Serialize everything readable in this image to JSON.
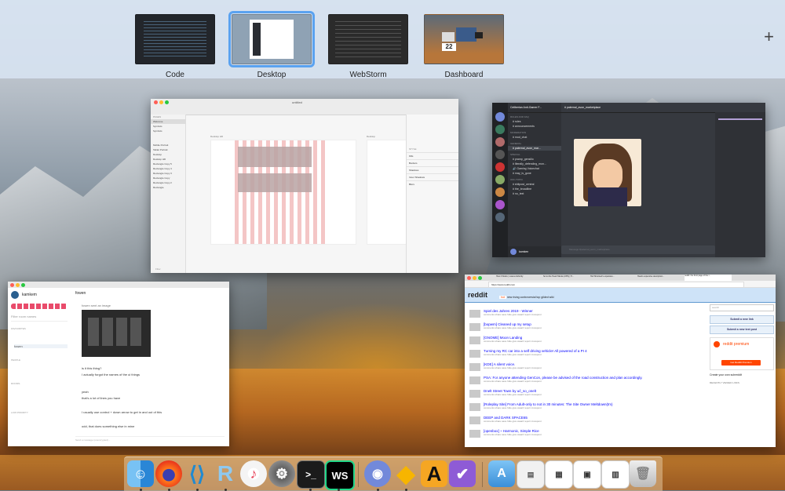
{
  "spaces": [
    {
      "label": "Code"
    },
    {
      "label": "Desktop",
      "selected": true
    },
    {
      "label": "WebStorm"
    },
    {
      "label": "Dashboard"
    }
  ],
  "add_space_icon": "plus-icon",
  "dashboard_clock": "22",
  "sketch": {
    "title": "untitled",
    "pages_header": "PAGES",
    "pages": [
      "Welcome",
      "Symbols",
      "Symbols"
    ],
    "layers": [
      "Mobile Portrait",
      "Tablet Portrait",
      "Desktop",
      "Desktop HD",
      "Rectangle Copy 5",
      "Rectangle Copy 4",
      "Rectangle Copy 3",
      "Rectangle Copy",
      "Rectangle Copy 2",
      "Rectangle"
    ],
    "artboard_label": "Desktop HD",
    "artboard2_label": "Desktop",
    "inspector": [
      "STYLE",
      "Fills",
      "Borders",
      "Shadows",
      "Inner Shadows",
      "Blurs"
    ],
    "filter_placeholder": "Filter"
  },
  "discord": {
    "server": "Celiberian Anti-Gamer F...",
    "channel": "paternal_avon_marketplace",
    "channels": [
      "rules",
      "announcements",
      "mod_chat",
      "paternal_avon_mar...",
      "pramp_gensilio",
      "literally_defending_mon...",
      "Gaming Voicechat",
      "may_is_gone",
      "shitpost_central",
      "the_broadline",
      "no_text"
    ],
    "categories": [
      "RULES AND FAQ",
      "MODERATION",
      "GENERAL",
      "SPECIAL",
      "OFF-TOPIC"
    ],
    "user": "kamken",
    "message_placeholder": "Message #paternal_avon_marketplace"
  },
  "chat": {
    "user": "kamkem",
    "filter_placeholder": "Filter room names",
    "sections": [
      "FAVOURITES",
      "PEOPLE",
      "ROOMS",
      "LOW PRIORITY"
    ],
    "rooms": [
      "fowen"
    ],
    "messages": [
      "fowen sent an image",
      "is it this thing?",
      "I actually forgot the names of the ui things",
      "yeah",
      "that's a lot of lines you have",
      "I usually use control + down arrow to get in and out of this",
      "odd, that does something else in mine"
    ],
    "composer_placeholder": "Send a message (unencrypted)..."
  },
  "browser": {
    "url": "https://www.reddit.com",
    "tabs": [
      "How it Works | Lowes Authority",
      "So let the Heart  Tabula (UPS) | Ti...",
      "Hell Shorsted's expansive...",
      "Hearts expensive description...",
      "reddit: the front page of the i..."
    ],
    "site": "reddit",
    "sort_tabs": [
      "hot",
      "new",
      "rising",
      "controversial",
      "top",
      "gilded",
      "wiki"
    ],
    "posts": [
      {
        "rank": "1",
        "score": "•",
        "title": "Spiel des Jahres 2019 - Winner"
      },
      {
        "rank": "2",
        "score": "•",
        "title": "[bopwm] Cleaned up my setup"
      },
      {
        "rank": "3",
        "score": "•",
        "title": "[GNOME] Moon Landing"
      },
      {
        "rank": "4",
        "score": "•",
        "title": "Turning my RC car into a self driving vehicle! All powered of a PI 4"
      },
      {
        "rank": "5",
        "score": "•",
        "title": "[KDE] A silent voice."
      },
      {
        "rank": "6",
        "score": "•",
        "title": "PSA: For anyone attending GenCon, please be advised of the road construction and plan accordingly."
      },
      {
        "rank": "7",
        "score": "•",
        "title": "Dnelt Street Town by u/i_so_onelt"
      },
      {
        "rank": "8",
        "score": "•",
        "title": "[Roleplay Site] From Adult-only to not in 30 minutes: The Site Owner Meltdown(tm)"
      },
      {
        "rank": "9",
        "score": "•",
        "title": "DEEP and DARK SPACE65"
      },
      {
        "rank": "10",
        "score": "•",
        "title": "[openbox] ~ Harmonic, Simple Rice"
      }
    ],
    "post_meta": "submitted 3 hours ago by user to r/subreddit",
    "post_actions": "comments   share   save   hide   give award   report   crosspost",
    "search_placeholder": "search",
    "submit_link": "Submit a new link",
    "submit_text": "Submit a new text post",
    "premium_title": "reddit premium",
    "premium_button": "Get Reddit Premium",
    "create_community": "Create your own subreddit",
    "recently_viewed": "RECENTLY VIEWED LINKS"
  },
  "colors": {
    "selection": "#5aa2f0",
    "reddit_blue": "#0000ff",
    "discord_bg": "#36393f",
    "sketch_column": "#f4c6c6"
  }
}
